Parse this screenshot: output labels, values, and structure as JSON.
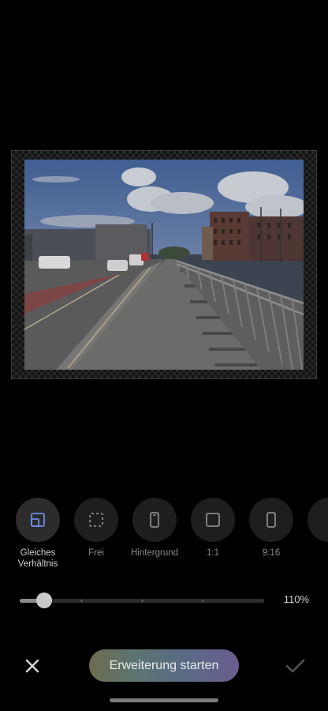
{
  "image_preview": {
    "description_icon": "photo-preview"
  },
  "aspect_options": [
    {
      "label": "Gleiches Verhältnis",
      "icon": "same-ratio-icon",
      "selected": true
    },
    {
      "label": "Frei",
      "icon": "free-crop-icon",
      "selected": false
    },
    {
      "label": "Hintergrund",
      "icon": "phone-background-icon",
      "selected": false
    },
    {
      "label": "1:1",
      "icon": "square-icon",
      "selected": false
    },
    {
      "label": "9:16",
      "icon": "portrait-ratio-icon",
      "selected": false
    }
  ],
  "zoom_slider": {
    "value_label": "110%",
    "level_fraction": 0.1
  },
  "bottom_bar": {
    "close_icon": "close-icon",
    "start_label": "Erweiterung starten",
    "confirm_icon": "checkmark-icon"
  },
  "colors": {
    "background": "#000000",
    "button_gradient": [
      "#6d6c4e",
      "#5c7470",
      "#5a6a86",
      "#6a5d8e"
    ]
  }
}
